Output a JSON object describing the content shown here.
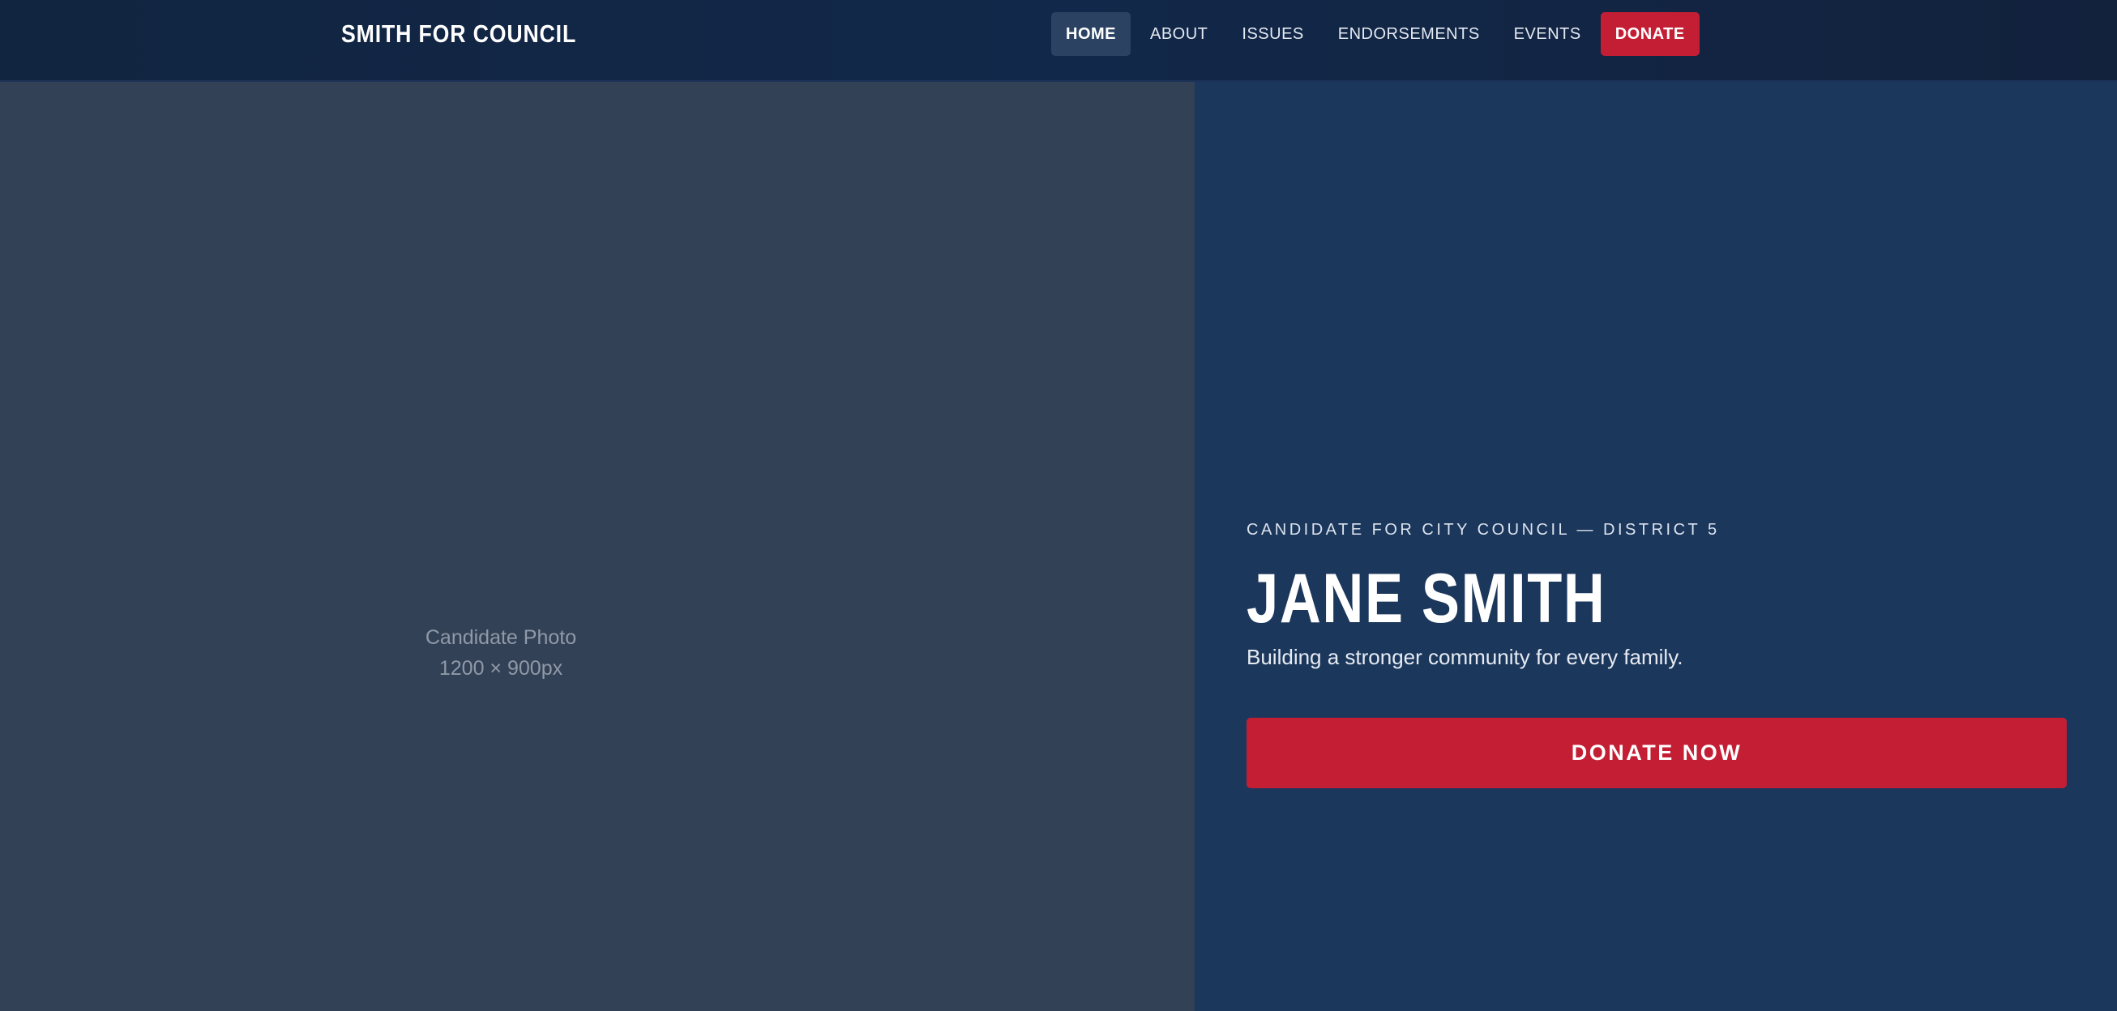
{
  "header": {
    "brand": "SMITH FOR COUNCIL",
    "nav": [
      {
        "label": "HOME",
        "active": true
      },
      {
        "label": "ABOUT"
      },
      {
        "label": "ISSUES"
      },
      {
        "label": "ENDORSEMENTS"
      },
      {
        "label": "EVENTS"
      },
      {
        "label": "DONATE",
        "style": "cta"
      }
    ]
  },
  "photo": {
    "caption_line1": "Candidate Photo",
    "caption_line2": "1200 × 900px"
  },
  "hero": {
    "eyebrow": "CANDIDATE FOR CITY COUNCIL — DISTRICT 5",
    "name": "JANE SMITH",
    "tagline": "Building a stronger community for every family.",
    "cta_label": "DONATE NOW"
  },
  "colors": {
    "header_bg": "#12284a",
    "hero_bg": "#1c375c",
    "photo_bg": "#334156",
    "accent_red": "#c41e34",
    "nav_active_bg": "#2c4263"
  }
}
